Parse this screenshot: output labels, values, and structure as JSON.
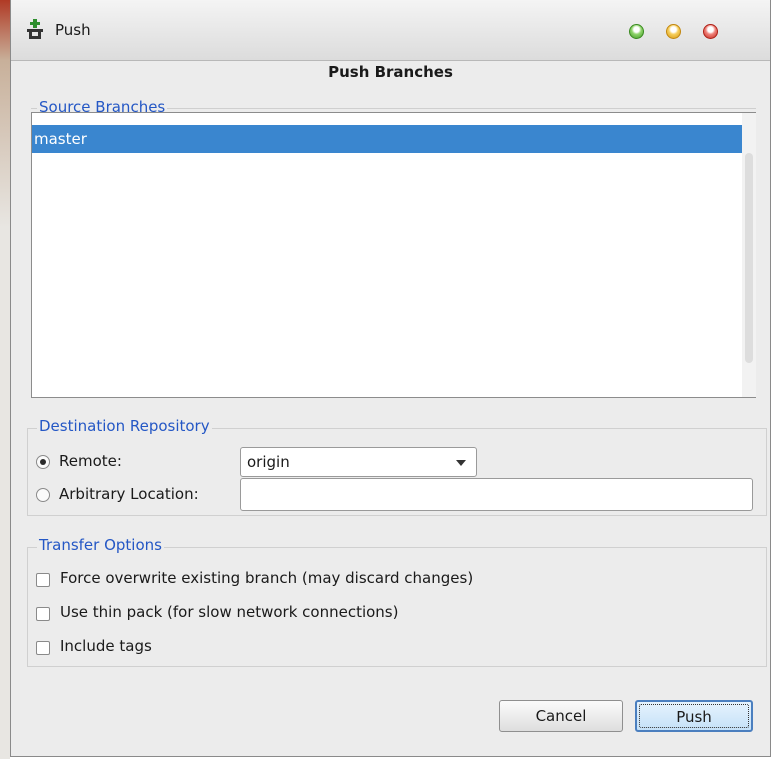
{
  "window": {
    "title": "Push",
    "icon": "git-push-icon",
    "controls": [
      "maximize-button",
      "minimize-button",
      "close-button"
    ]
  },
  "dialog": {
    "heading": "Push Branches"
  },
  "source_branches": {
    "legend": "Source Branches",
    "items": [
      {
        "label": "master",
        "selected": true
      }
    ]
  },
  "destination": {
    "legend": "Destination Repository",
    "remote_label": "Remote:",
    "remote_selected": true,
    "remote_value": "origin",
    "arbitrary_label": "Arbitrary Location:",
    "arbitrary_value": ""
  },
  "transfer": {
    "legend": "Transfer Options",
    "options": [
      {
        "label": "Force overwrite existing branch (may discard changes)",
        "checked": false
      },
      {
        "label": "Use thin pack (for slow network connections)",
        "checked": false
      },
      {
        "label": "Include tags",
        "checked": false
      }
    ]
  },
  "buttons": {
    "cancel": "Cancel",
    "push": "Push"
  },
  "colors": {
    "selection": "#3a86cf",
    "legend": "#2457c5",
    "dialog_bg": "#ececec"
  }
}
